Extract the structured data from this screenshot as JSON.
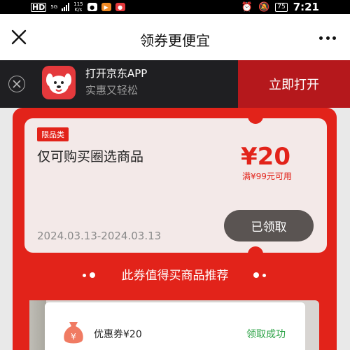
{
  "status_bar": {
    "network_badge": "HD",
    "network_type_label": "5G",
    "speed_value": "115",
    "speed_unit": "K/s",
    "battery_level": "75",
    "time": "7:21",
    "icons": [
      "hd-icon",
      "signal-icon",
      "wechat-icon",
      "orange-app-icon",
      "jd-app-icon",
      "alarm-icon",
      "mute-icon",
      "battery-icon"
    ]
  },
  "nav": {
    "title": "领券更便宜",
    "close_icon": "close-icon",
    "more_icon": "more-icon"
  },
  "app_banner": {
    "title": "打开京东APP",
    "subtitle": "实惠又轻松",
    "open_button": "立即打开",
    "close_icon": "close-circle-icon",
    "logo_icon": "jd-dog-logo-icon"
  },
  "coupon": {
    "tag": "限品类",
    "description": "仅可购买圈选商品",
    "amount": "¥20",
    "condition": "满¥99元可用",
    "validity": "2024.03.13-2024.03.13",
    "button": "已领取"
  },
  "recommend": {
    "title": "此券值得买商品推荐"
  },
  "bottom_card": {
    "label": "优惠券¥20",
    "status": "领取成功",
    "icon": "money-bag-icon"
  },
  "colors": {
    "brand_red": "#e2231a",
    "dark_red": "#b5181c",
    "success_green": "#2ba245",
    "banner_bg": "#1f1f22"
  }
}
